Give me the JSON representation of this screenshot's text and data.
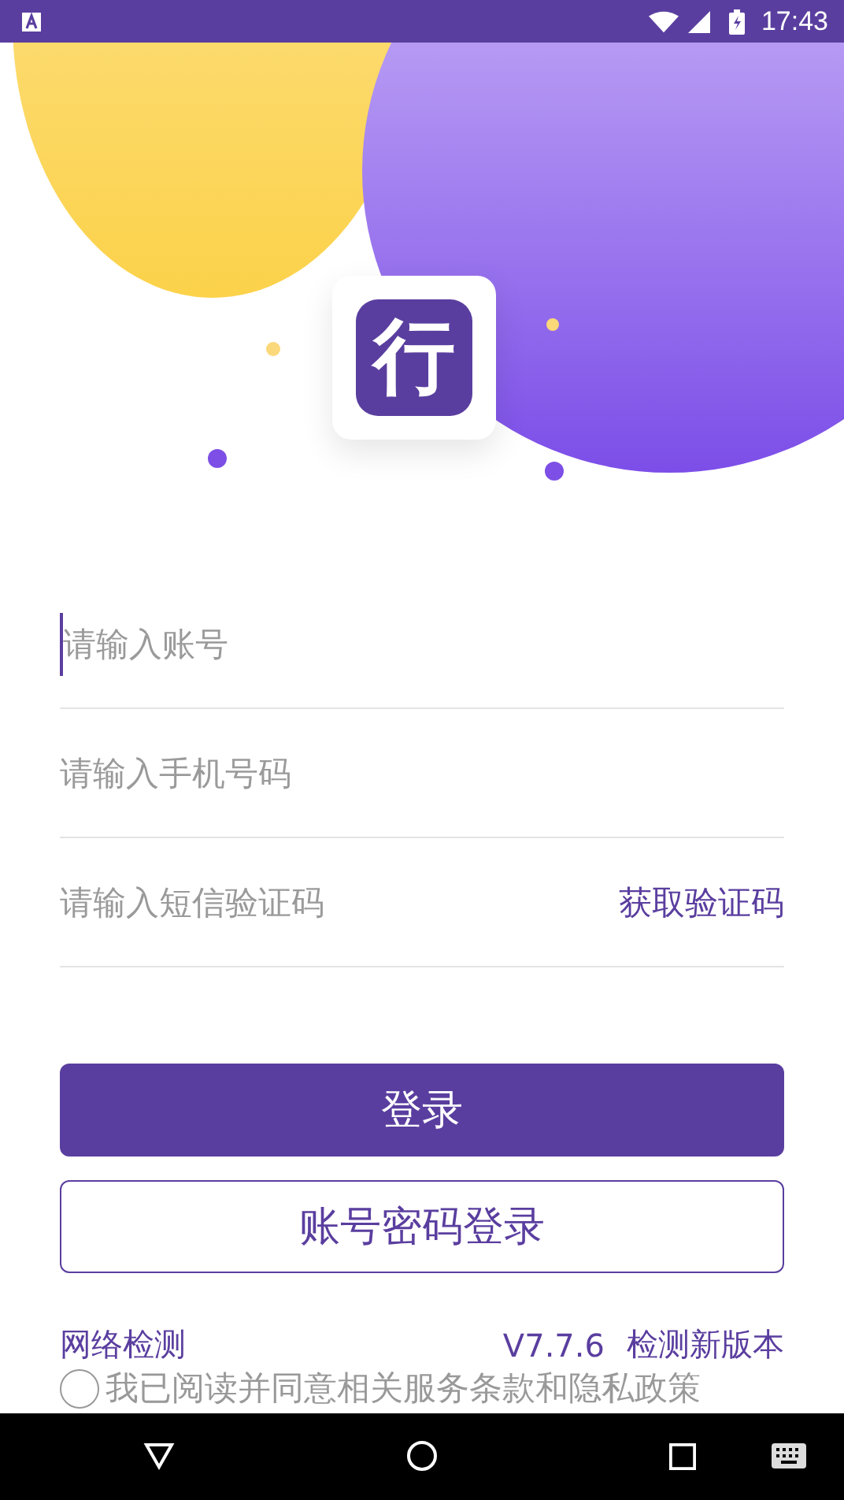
{
  "status_bar": {
    "time": "17:43"
  },
  "logo": {
    "text": "行"
  },
  "fields": [
    {
      "placeholder": "请输入账号",
      "focused": true
    },
    {
      "placeholder": "请输入手机号码",
      "focused": false
    },
    {
      "placeholder": "请输入短信验证码",
      "focused": false,
      "action": "获取验证码"
    }
  ],
  "buttons": [
    {
      "label": "登录",
      "kind": "primary"
    },
    {
      "label": "账号密码登录",
      "kind": "outline"
    }
  ],
  "footer": {
    "left_link": "网络检测",
    "version": "V7.7.6",
    "right_link": "检测新版本"
  },
  "agreement": {
    "text": "我已阅读并同意相关服务条款和隐私政策",
    "checked": false
  }
}
